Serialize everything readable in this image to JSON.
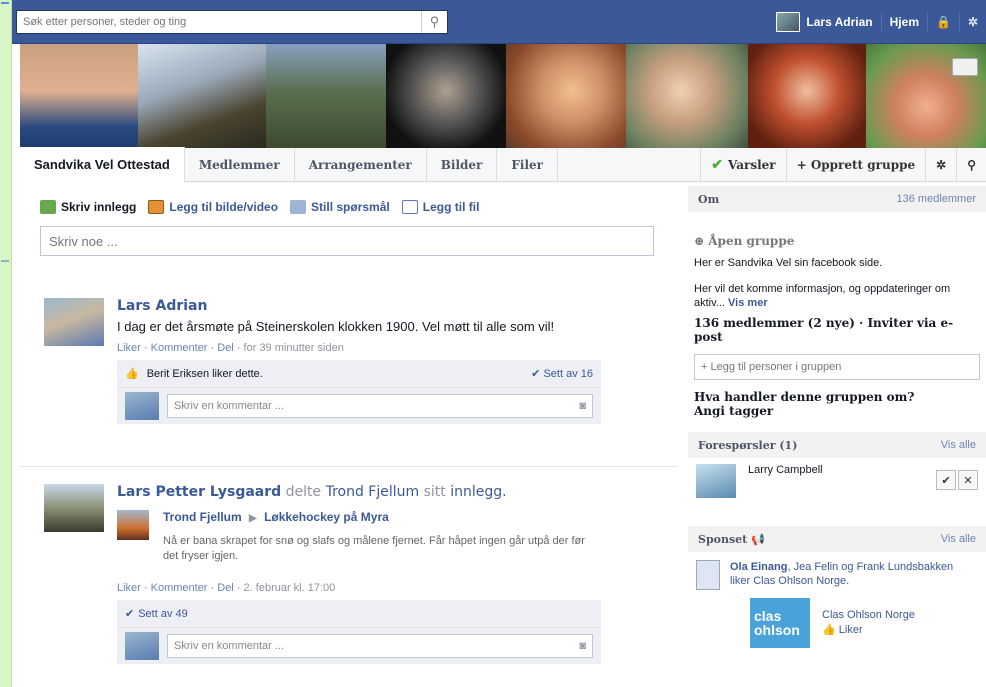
{
  "topbar": {
    "search_placeholder": "Søk etter personer, steder og ting",
    "user_name": "Lars Adrian",
    "home_label": "Hjem"
  },
  "group": {
    "tabs": [
      "Sandvika Vel Ottestad",
      "Medlemmer",
      "Arrangementer",
      "Bilder",
      "Filer"
    ],
    "notifications_label": "Varsler",
    "create_group_label": "+ Opprett gruppe"
  },
  "composer": {
    "actions": [
      "Skriv innlegg",
      "Legg til bilde/video",
      "Still spørsmål",
      "Legg til fil"
    ],
    "placeholder": "Skriv noe ..."
  },
  "posts": [
    {
      "author": "Lars Adrian",
      "text": "I dag er det årsmøte på Steinerskolen klokken 1900. Vel møtt til alle som vil!",
      "actions": "Liker · Kommenter · Del ·",
      "time": "for 39 minutter siden",
      "likes_text": "Berit Eriksen liker dette.",
      "seen": "Sett av 16",
      "comment_placeholder": "Skriv en kommentar ..."
    },
    {
      "author": "Lars Petter Lysgaard",
      "shared_word": "delte",
      "shared_person": "Trond Fjellum",
      "shared_suffix": "sitt",
      "shared_link": "innlegg.",
      "shared_title_a": "Trond Fjellum",
      "shared_title_b": "Løkkehockey på Myra",
      "shared_text": "Nå er bana skrapet for snø og slafs og målene fjernet. Får håpet ingen går utpå der før det fryser igjen.",
      "actions": "Liker · Kommenter · Del ·",
      "time": "2. februar kl. 17:00",
      "seen": "Sett av 49",
      "comment_placeholder": "Skriv en kommentar ..."
    }
  ],
  "sidebar": {
    "about_title": "Om",
    "member_count_link": "136 medlemmer",
    "open_group": "Åpen gruppe",
    "description1": "Her er Sandvika Vel sin facebook side.",
    "description2": "Her vil det komme informasjon, og oppdateringer om aktiv...",
    "see_more": "Vis mer",
    "members_line": "136 medlemmer (2 nye) ·",
    "invite_link": "Inviter via e-post",
    "add_people_placeholder": "+ Legg til personer i gruppen",
    "topic_question": "Hva handler denne gruppen om?",
    "add_tags": "Angi tagger",
    "requests_title": "Forespørsler (1)",
    "see_all": "Vis alle",
    "request_name": "Larry Campbell",
    "sponsored_title": "Sponset",
    "sponsored_see_all": "Vis alle",
    "ad1_name": "Ola Einang",
    "ad1_rest": ", Jea Felin og Frank Lundsbakken liker Clas Ohlson Norge.",
    "ad2_logo_a": "clas",
    "ad2_logo_b": "ohlson",
    "ad2_name": "Clas Ohlson Norge",
    "ad2_like": "Liker"
  }
}
